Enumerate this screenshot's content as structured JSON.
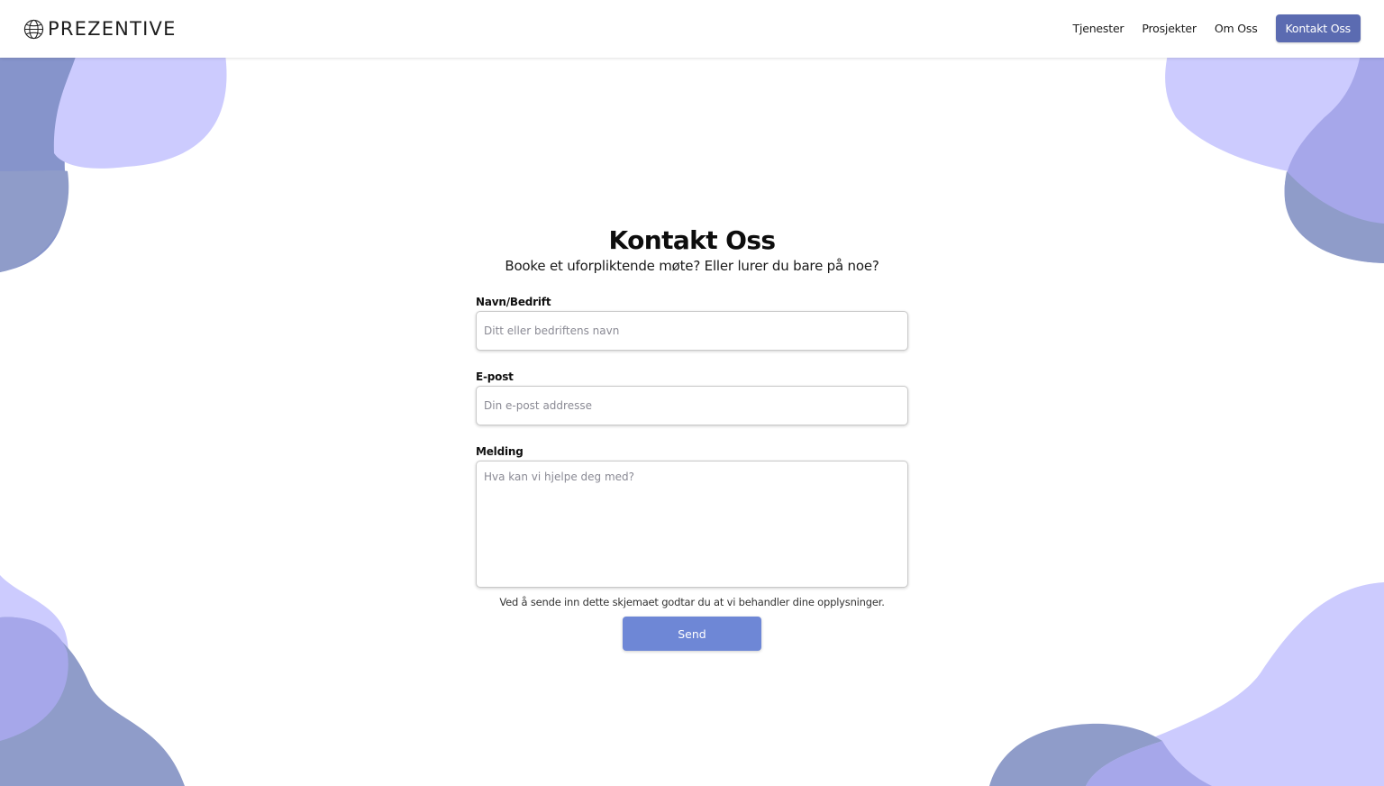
{
  "brand": {
    "name": "PREZENTIVE",
    "icon": "globe-icon"
  },
  "nav": {
    "items": [
      {
        "label": "Tjenester"
      },
      {
        "label": "Prosjekter"
      },
      {
        "label": "Om Oss"
      }
    ],
    "cta_label": "Kontakt Oss"
  },
  "contact": {
    "title": "Kontakt Oss",
    "subtitle": "Booke et uforpliktende møte? Eller lurer du bare på noe?",
    "fields": {
      "name": {
        "label": "Navn/Bedrift",
        "placeholder": "Ditt eller bedriftens navn",
        "value": ""
      },
      "email": {
        "label": "E-post",
        "placeholder": "Din e-post addresse",
        "value": ""
      },
      "message": {
        "label": "Melding",
        "placeholder": "Hva kan vi hjelpe deg med?",
        "value": ""
      }
    },
    "consent": "Ved å sende inn dette skjemaet godtar du at vi behandler dine opplysninger.",
    "submit_label": "Send"
  },
  "colors": {
    "blob_light": "#cccbfe",
    "blob_medium": "#a6a7ea",
    "blob_dark": "#8f9cc9",
    "blob_deep": "#7f8ec8",
    "accent_nav": "#5b6bb1",
    "accent_button": "#6e87d6"
  }
}
